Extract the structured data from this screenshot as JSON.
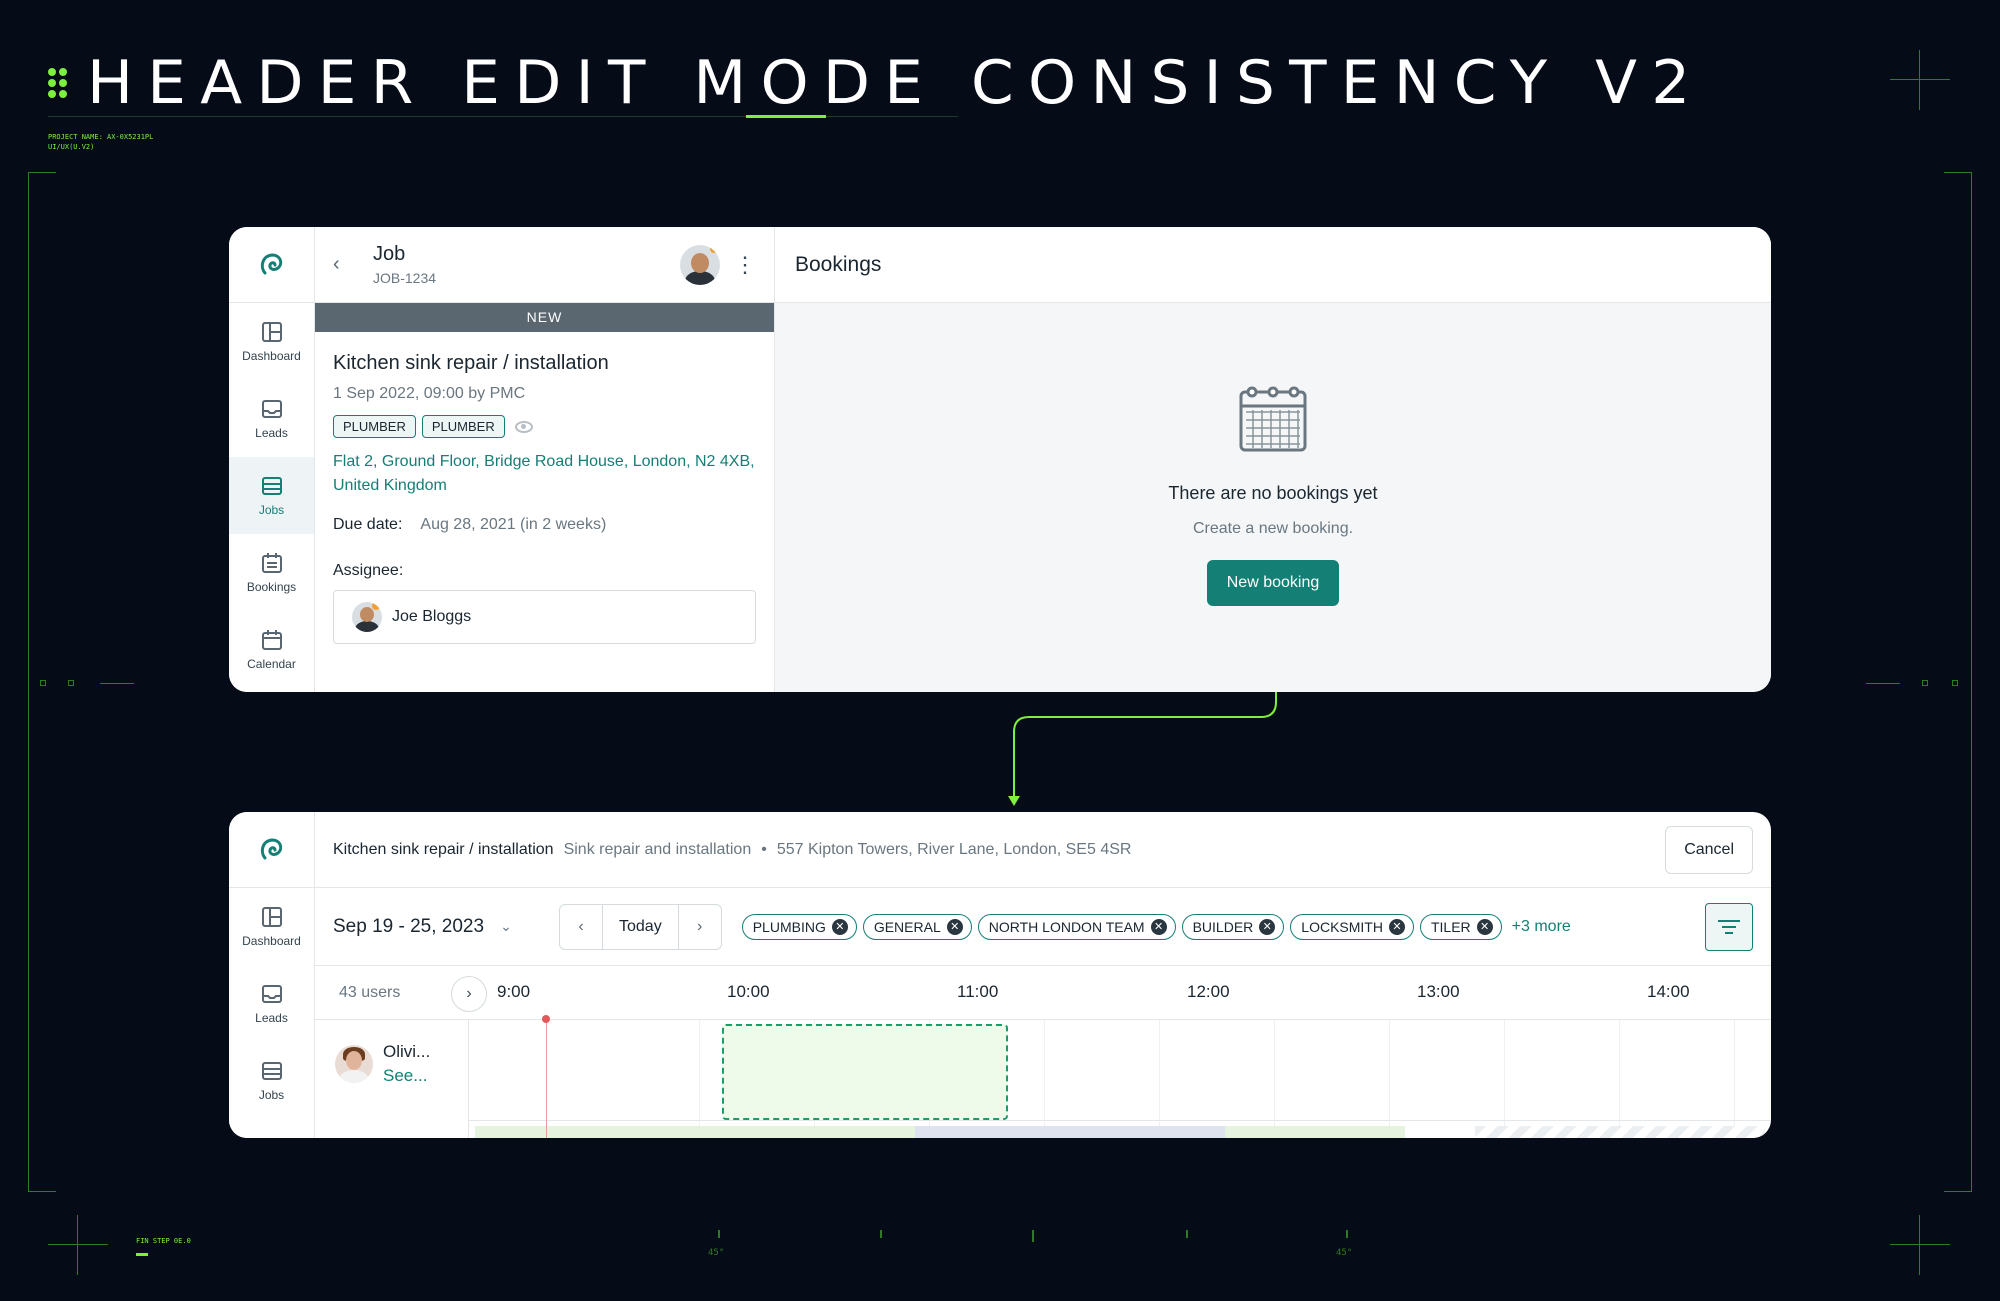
{
  "presentation": {
    "title": "HEADER EDIT MODE CONSISTENCY V2",
    "project_line1": "PROJECT NAME: AX-0X5231PL",
    "project_line2": "UI/UX(U.V2)",
    "footer_label": "FIN STEP 0E.0",
    "degree_left": "45°",
    "degree_right": "45°"
  },
  "colors": {
    "accent": "#147f74",
    "hud_green": "#7cf03c",
    "background": "#050b17"
  },
  "nav": {
    "items": [
      {
        "label": "Dashboard",
        "icon": "dashboard-icon"
      },
      {
        "label": "Leads",
        "icon": "inbox-icon"
      },
      {
        "label": "Jobs",
        "icon": "jobs-icon",
        "active": true
      },
      {
        "label": "Bookings",
        "icon": "bookings-icon"
      },
      {
        "label": "Calendar",
        "icon": "calendar-icon"
      }
    ]
  },
  "job": {
    "title": "Job",
    "id": "JOB-1234",
    "status": "NEW",
    "name": "Kitchen sink repair / installation",
    "created": "1 Sep 2022, 09:00 by PMC",
    "tags": [
      "PLUMBER",
      "PLUMBER"
    ],
    "address": "Flat 2, Ground Floor, Bridge Road House, London, N2 4XB, United Kingdom",
    "due_label": "Due date:",
    "due_value": "Aug 28, 2021 (in 2 weeks)",
    "assignee_label": "Assignee:",
    "assignee_name": "Joe Bloggs"
  },
  "bookings": {
    "title": "Bookings",
    "empty_title": "There are no bookings yet",
    "empty_sub": "Create a new booking.",
    "new_button": "New booking"
  },
  "scheduler": {
    "job_title": "Kitchen sink repair / installation",
    "job_subtitle": "Sink repair and installation",
    "separator": "•",
    "address": "557 Kipton Towers, River Lane, London, SE5 4SR",
    "cancel": "Cancel",
    "date_range": "Sep 19 - 25, 2023",
    "today": "Today",
    "filters": [
      "PLUMBING",
      "GENERAL",
      "NORTH LONDON TEAM",
      "BUILDER",
      "LOCKSMITH",
      "TILER"
    ],
    "more_filters": "+3 more",
    "users_count": "43 users",
    "hours": [
      "9:00",
      "10:00",
      "11:00",
      "12:00",
      "13:00",
      "14:00"
    ],
    "user": {
      "name": "Olivi...",
      "link": "See..."
    }
  }
}
